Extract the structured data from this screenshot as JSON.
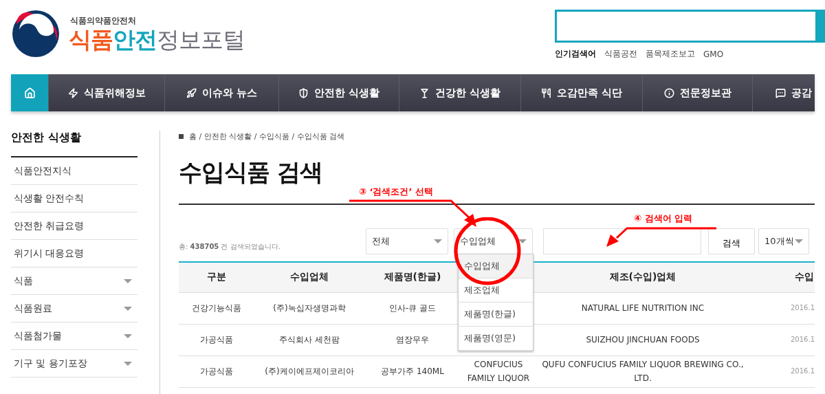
{
  "header": {
    "agency": "식품의약품안전처",
    "title_parts": [
      {
        "text": "식품",
        "color": "#f25a1f"
      },
      {
        "text": "안전",
        "color": "#13a6bd"
      },
      {
        "text": "정보포털",
        "color": "#6d6e78"
      }
    ]
  },
  "popular": {
    "label": "인기검색어",
    "keywords": [
      "식품공전",
      "품목제조보고",
      "GMO"
    ]
  },
  "nav": [
    {
      "kind": "home",
      "selected": true
    },
    {
      "kind": "bolt",
      "label": "식품위해정보",
      "selected": false
    },
    {
      "kind": "rocket",
      "label": "이슈와 뉴스",
      "selected": false
    },
    {
      "kind": "shield",
      "label": "안전한 식생활",
      "selected": false
    },
    {
      "kind": "glass",
      "label": "건강한 식생활",
      "selected": false
    },
    {
      "kind": "utensils",
      "label": "오감만족 식단",
      "selected": false
    },
    {
      "kind": "info",
      "label": "전문정보관",
      "selected": false
    },
    {
      "kind": "chat",
      "label": "공감",
      "selected": false
    }
  ],
  "sidebar": {
    "title": "안전한 식생활",
    "items": [
      {
        "label": "식품안전지식",
        "expandable": false
      },
      {
        "label": "식생활 안전수칙",
        "expandable": false
      },
      {
        "label": "안전한 취급요령",
        "expandable": false
      },
      {
        "label": "위기시 대응요령",
        "expandable": false
      },
      {
        "label": "식품",
        "expandable": true
      },
      {
        "label": "식품원료",
        "expandable": true
      },
      {
        "label": "식품첨가물",
        "expandable": true
      },
      {
        "label": "기구 및 용기포장",
        "expandable": true
      }
    ]
  },
  "breadcrumb": "홈 / 안전한 식생활 / 수입식품 / 수입식품 검색",
  "page_title": "수입식품 검색",
  "result_count": "총: **438705** 건 검색되었습니다.",
  "filters": {
    "scope": "전체",
    "field": {
      "value": "수입업체",
      "expanded": true,
      "options": [
        {
          "label": "수입업체",
          "selected": true
        },
        {
          "label": "제조업체",
          "selected": false
        },
        {
          "label": "제품명(한글)",
          "selected": false
        },
        {
          "label": "제품명(영문)",
          "selected": false
        }
      ]
    },
    "search_button": "검색",
    "page_size": "10개씩"
  },
  "table": {
    "columns": [
      "구분",
      "수입업체",
      "제품명(한글)",
      null,
      "제조(수입)업체",
      "수입"
    ],
    "rows": [
      {
        "cells": [
          "건강기능식품",
          "(주)녹십자생명과학",
          "인사-큐 골드",
          null,
          "NATURAL LIFE NUTRITION INC",
          "2016.1"
        ]
      },
      {
        "cells": [
          "가공식품",
          "주식회사 세천팜",
          "염장무우",
          null,
          "SUIZHOU JINCHUAN FOODS",
          "2016.1"
        ]
      },
      {
        "cells": [
          "가공식품",
          "(주)케이에프제이코리아",
          "공부가주 140ML",
          "CONFUCIUS FAMILY LIQUOR",
          "QUFU CONFUCIUS FAMILY LIQUOR BREWING CO., LTD.",
          "2016.1"
        ]
      }
    ]
  },
  "annotations": [
    {
      "kind": "select_hint",
      "label": "③ ‘검색조건’ 선택"
    },
    {
      "kind": "input_hint",
      "label": "④ 검색어 입력"
    }
  ]
}
